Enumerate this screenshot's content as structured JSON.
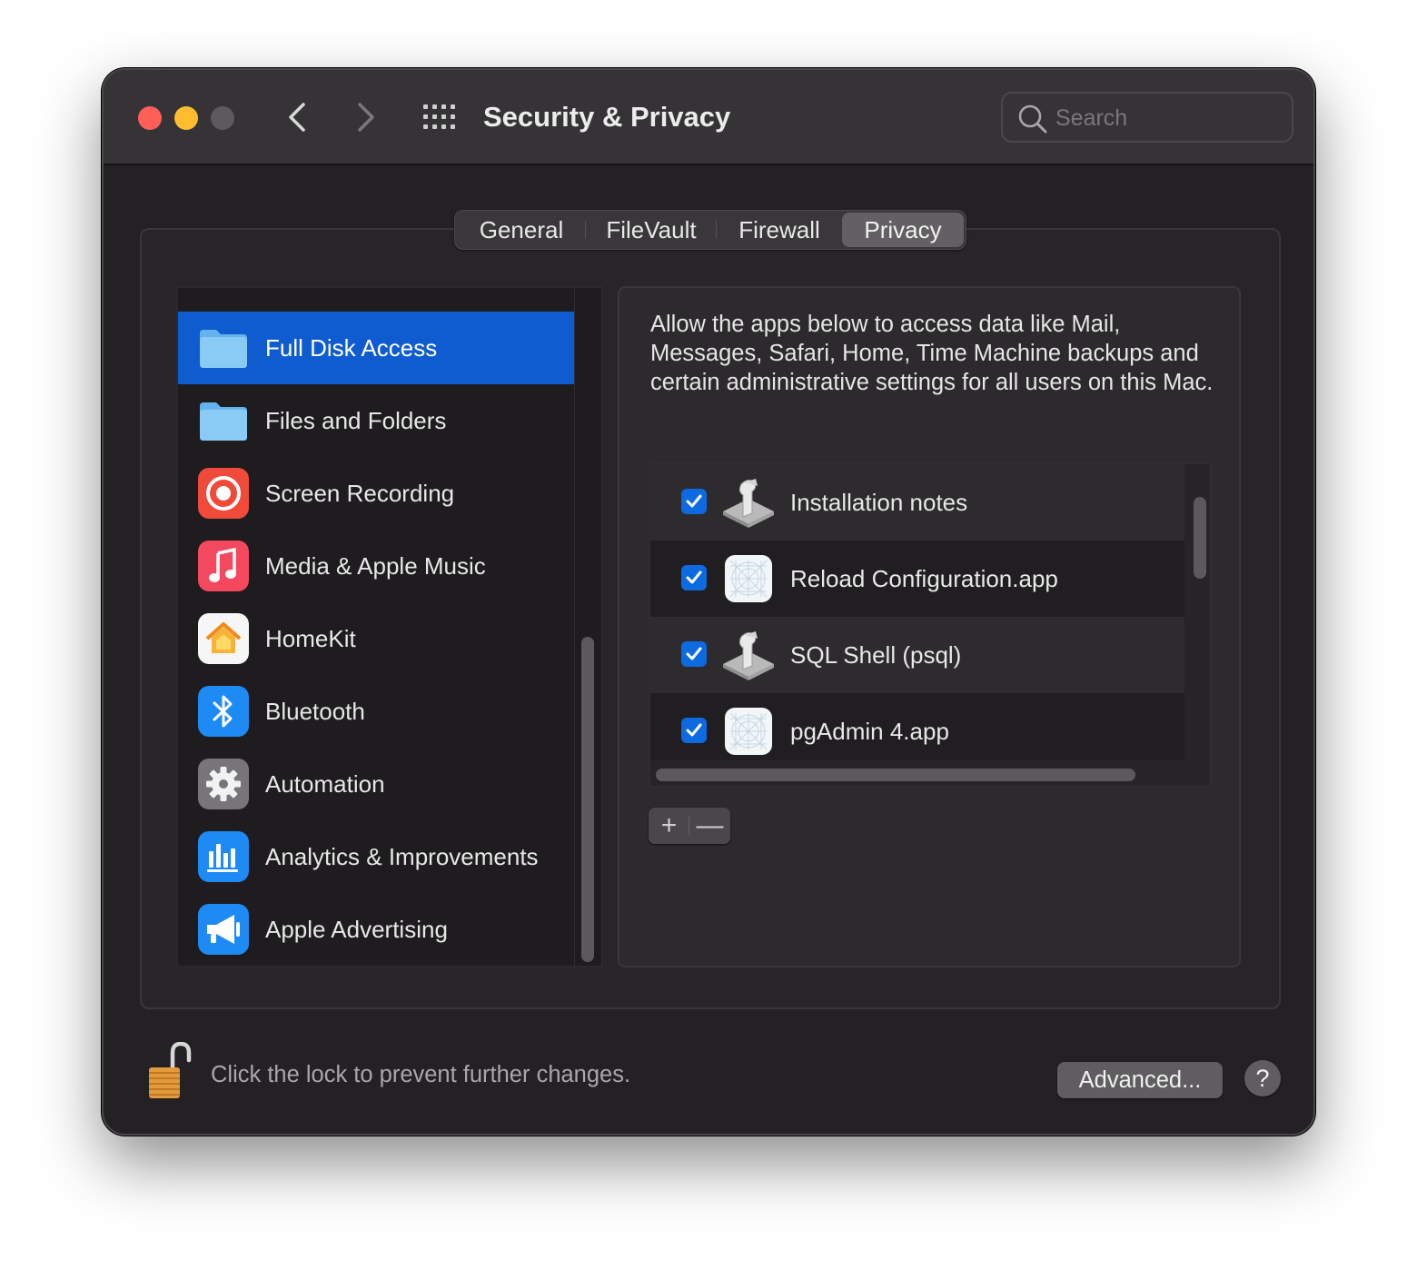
{
  "window": {
    "title": "Security & Privacy",
    "search_placeholder": "Search"
  },
  "tabs": [
    {
      "label": "General",
      "active": false
    },
    {
      "label": "FileVault",
      "active": false
    },
    {
      "label": "Firewall",
      "active": false
    },
    {
      "label": "Privacy",
      "active": true
    }
  ],
  "sidebar": {
    "items": [
      {
        "label": "Full Disk Access",
        "icon": "folder-icon",
        "selected": true
      },
      {
        "label": "Files and Folders",
        "icon": "folder-icon",
        "selected": false
      },
      {
        "label": "Screen Recording",
        "icon": "screen-recording-icon",
        "selected": false
      },
      {
        "label": "Media & Apple Music",
        "icon": "music-note-icon",
        "selected": false
      },
      {
        "label": "HomeKit",
        "icon": "home-icon",
        "selected": false
      },
      {
        "label": "Bluetooth",
        "icon": "bluetooth-icon",
        "selected": false
      },
      {
        "label": "Automation",
        "icon": "gear-icon",
        "selected": false
      },
      {
        "label": "Analytics & Improvements",
        "icon": "bar-chart-icon",
        "selected": false
      },
      {
        "label": "Apple Advertising",
        "icon": "megaphone-icon",
        "selected": false
      }
    ]
  },
  "privacy": {
    "description": "Allow the apps below to access data like Mail, Messages, Safari, Home, Time Machine backups and certain administrative settings for all users on this Mac.",
    "apps": [
      {
        "name": "Installation notes",
        "checked": true,
        "icon": "script-icon"
      },
      {
        "name": "Reload Configuration.app",
        "checked": true,
        "icon": "app-placeholder-icon"
      },
      {
        "name": "SQL Shell (psql)",
        "checked": true,
        "icon": "script-icon"
      },
      {
        "name": "pgAdmin 4.app",
        "checked": true,
        "icon": "app-placeholder-icon"
      }
    ],
    "add_label": "+",
    "remove_label": "—"
  },
  "footer": {
    "lock_text": "Click the lock to prevent further changes.",
    "advanced_label": "Advanced...",
    "help_label": "?"
  },
  "colors": {
    "accent": "#0f5bd0",
    "close": "#fe5f57",
    "minimize": "#febc2e"
  }
}
